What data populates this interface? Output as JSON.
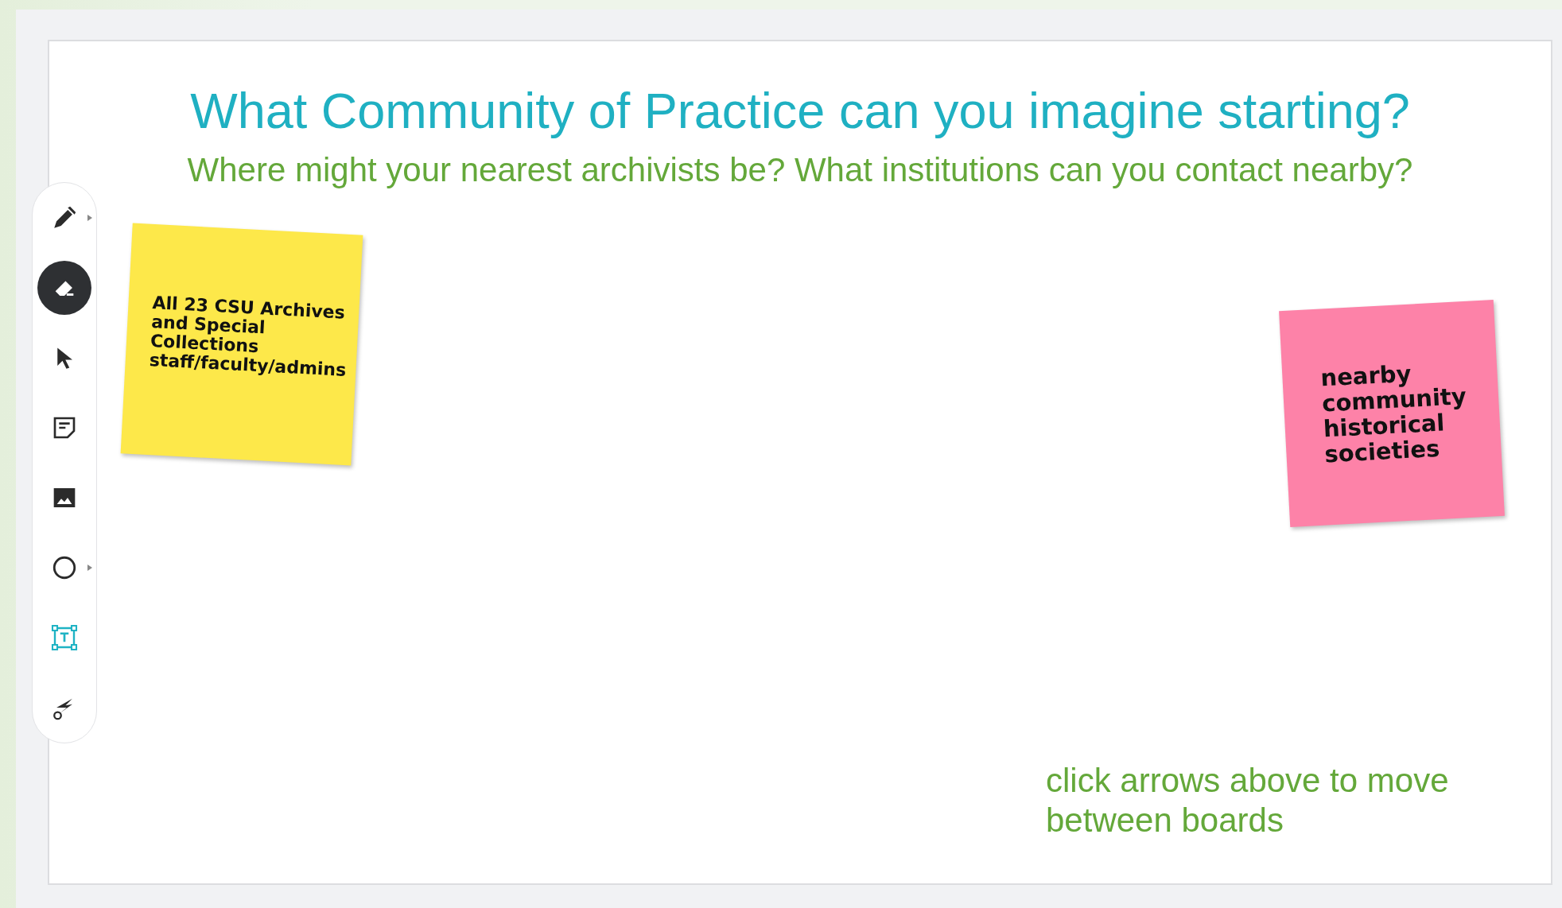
{
  "board": {
    "title": "What Community of Practice can you imagine starting?",
    "subtitle": "Where might your nearest archivists be? What institutions can you contact nearby?",
    "notes": [
      {
        "text": "All 23 CSU Archives and Special Collections staff/faculty/admins",
        "color": "#fde84a"
      },
      {
        "text": "nearby community historical societies",
        "color": "#fd82a8"
      }
    ],
    "hint": "click arrows above to move between boards"
  },
  "toolbar": {
    "tools": [
      {
        "kind": "pen",
        "selected": false,
        "menu": true
      },
      {
        "kind": "eraser",
        "selected": true,
        "menu": false
      },
      {
        "kind": "select",
        "selected": false,
        "menu": false
      },
      {
        "kind": "note",
        "selected": false,
        "menu": false
      },
      {
        "kind": "image",
        "selected": false,
        "menu": false
      },
      {
        "kind": "shape",
        "selected": false,
        "menu": true
      },
      {
        "kind": "text",
        "selected": false,
        "menu": false
      },
      {
        "kind": "laser",
        "selected": false,
        "menu": false
      }
    ]
  }
}
